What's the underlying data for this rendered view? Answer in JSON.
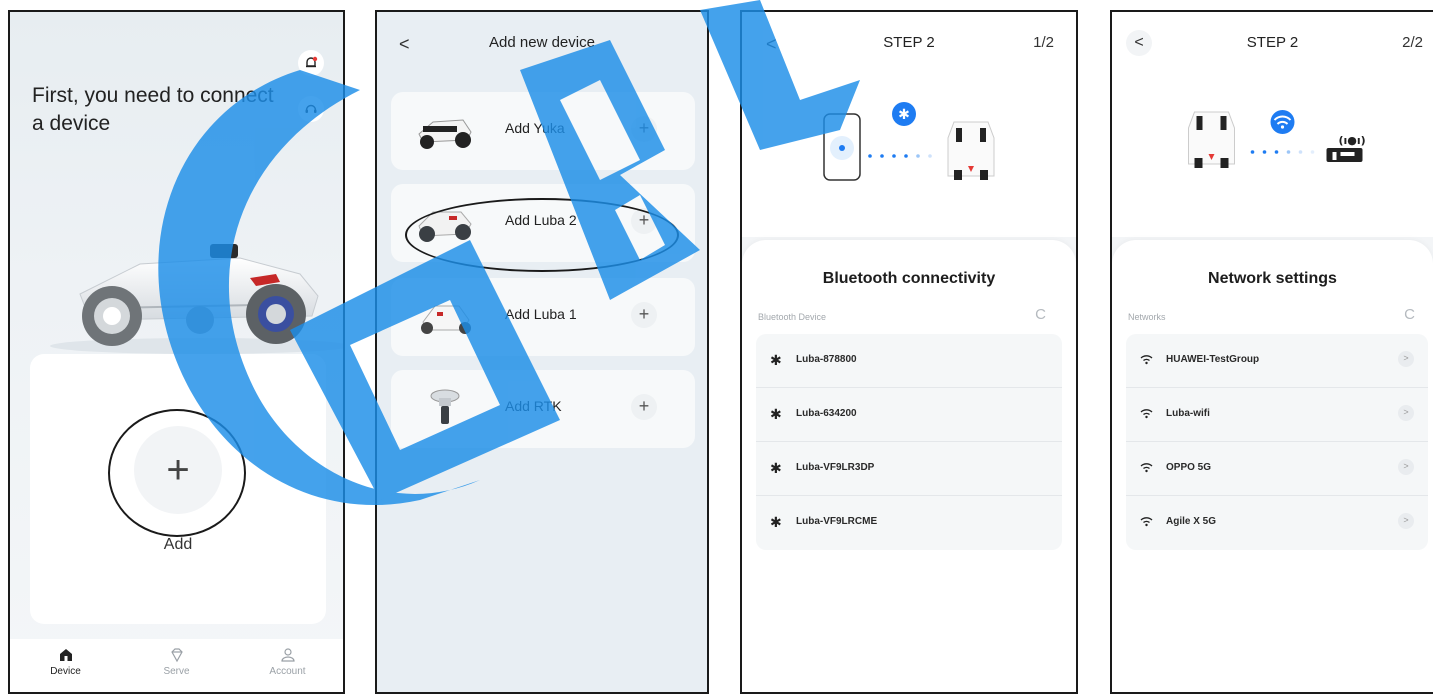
{
  "screen1": {
    "title": "First, you need to connect a device",
    "add_label": "Add",
    "add_symbol": "+",
    "tabs": [
      {
        "label": "Device",
        "icon": "home-icon",
        "active": true
      },
      {
        "label": "Serve",
        "icon": "diamond-icon",
        "active": false
      },
      {
        "label": "Account",
        "icon": "person-icon",
        "active": false
      }
    ]
  },
  "screen2": {
    "title": "Add new device",
    "back": "<",
    "devices": [
      {
        "name": "Add Yuka",
        "plus": "+"
      },
      {
        "name": "Add Luba 2",
        "plus": "+"
      },
      {
        "name": "Add Luba 1",
        "plus": "+"
      },
      {
        "name": "Add RTK",
        "plus": "+"
      }
    ]
  },
  "screen3": {
    "title": "STEP 2",
    "count": "1/2",
    "back": "<",
    "sheet_title": "Bluetooth connectivity",
    "section_label": "Bluetooth Device",
    "refresh": "C",
    "items": [
      "Luba-878800",
      "Luba-634200",
      "Luba-VF9LR3DP",
      "Luba-VF9LRCME"
    ]
  },
  "screen4": {
    "title": "STEP 2",
    "count": "2/2",
    "back": "<",
    "sheet_title": "Network settings",
    "section_label": "Networks",
    "refresh": "C",
    "items": [
      "HUAWEI-TestGroup",
      "Luba-wifi",
      "OPPO 5G",
      "Agile X 5G"
    ],
    "chevron": ">"
  },
  "colors": {
    "accent_blue": "#1e7cf2",
    "watermark_blue": "#1c8ee8",
    "alert_red": "#e53935"
  }
}
